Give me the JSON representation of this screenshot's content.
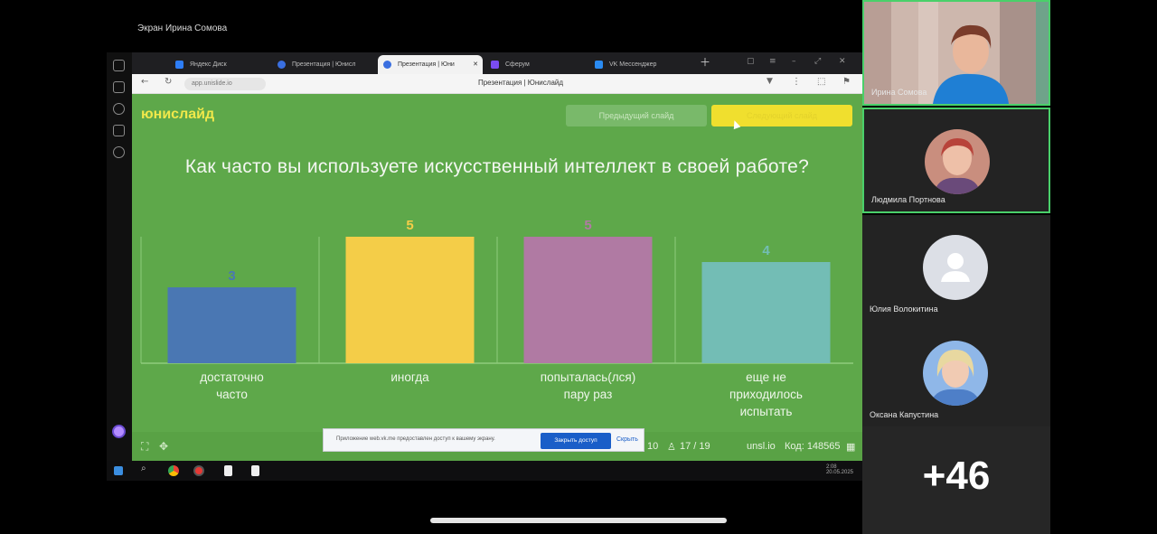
{
  "share_label": "Экран Ирина Сомова",
  "browser": {
    "tabs": [
      {
        "label": "Яндекс Диск",
        "color": "#2d7df6"
      },
      {
        "label": "Презентация | Юнисл",
        "color": "#3a6fe0"
      },
      {
        "label": "Презентация | Юни",
        "color": "#3a6fe0"
      },
      {
        "label": "Сферум",
        "color": "#7a4cf0"
      },
      {
        "label": "VK Мессенджер",
        "color": "#2a8bf2"
      }
    ],
    "url": "app.unislide.io",
    "page_title": "Презентация | Юнислайд"
  },
  "slide": {
    "logo": "юнислайд",
    "prev_label": "Предыдущий слайд",
    "next_label": "Следующий слайд",
    "question": "Как часто вы используете искусственный интеллект в своей работе?",
    "footer": {
      "count": "10",
      "slide_pos": "17 / 19",
      "site": "unsl.io",
      "code": "Код: 148565"
    }
  },
  "chart_data": {
    "type": "bar",
    "categories": [
      "достаточно часто",
      "иногда",
      "попыталась(лся) пару раз",
      "еще не приходилось испытать"
    ],
    "category_lines": [
      [
        "достаточно",
        "часто"
      ],
      [
        "иногда"
      ],
      [
        "попыталась(лся)",
        "пару раз"
      ],
      [
        "еще не",
        "приходилось",
        "испытать"
      ]
    ],
    "values": [
      3,
      5,
      5,
      4
    ],
    "colors": [
      "#4a77b3",
      "#f4cd48",
      "#b07aa3",
      "#73bdb5"
    ],
    "ylim": [
      0,
      5
    ],
    "grid": false
  },
  "notice": {
    "text": "Приложение web.vk.me предоставлен доступ к вашему экрану.",
    "action": "Закрыть доступ",
    "hide": "Скрыть"
  },
  "participants": [
    {
      "name": "Ирина Сомова",
      "speaking": true
    },
    {
      "name": "Людмила Портнова",
      "speaking": true
    },
    {
      "name": "Юлия Волокитина",
      "speaking": false
    },
    {
      "name": "Оксана Капустина",
      "speaking": false
    }
  ],
  "more_count": "+46",
  "tray_time": "2:08",
  "tray_date": "20.05.2025"
}
